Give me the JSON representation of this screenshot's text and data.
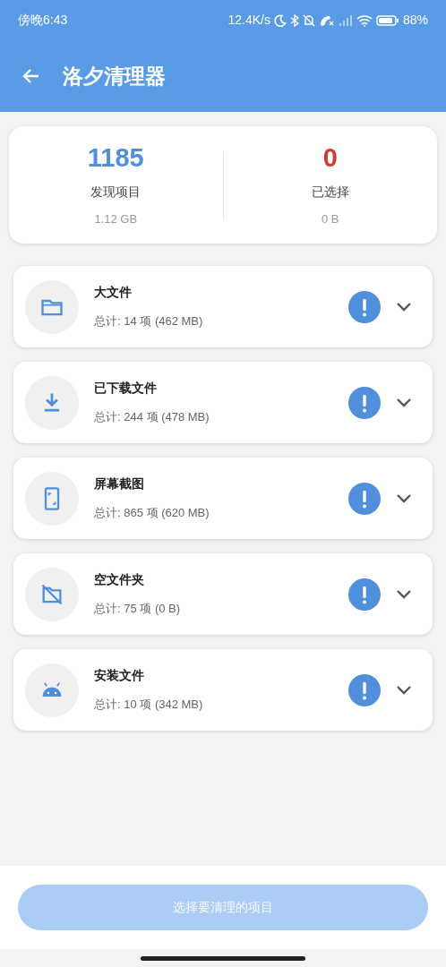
{
  "status_bar": {
    "time": "傍晚6:43",
    "net_speed": "12.4K/s",
    "battery": "88%"
  },
  "app_bar": {
    "title": "洛夕清理器"
  },
  "summary": [
    {
      "kind": "found",
      "value": "1185",
      "label": "发现项目",
      "size": "1.12 GB"
    },
    {
      "kind": "selected",
      "value": "0",
      "label": "已选择",
      "size": "0 B"
    }
  ],
  "categories": [
    {
      "kind": "folder",
      "title": "大文件",
      "detail": "总计: 14 项 (462 MB)",
      "expanded": false
    },
    {
      "kind": "download",
      "title": "已下载文件",
      "detail": "总计: 244 项 (478 MB)",
      "expanded": false
    },
    {
      "kind": "screenshot",
      "title": "屏幕截图",
      "detail": "总计: 865 项 (620 MB)",
      "expanded": false
    },
    {
      "kind": "empty_folder",
      "title": "空文件夹",
      "detail": "总计: 75 项 (0 B)",
      "expanded": false
    },
    {
      "kind": "apk",
      "title": "安装文件",
      "detail": "总计: 10 项 (342 MB)",
      "expanded": false
    }
  ],
  "action_button": {
    "label": "选择要清理的项目",
    "disabled": true
  }
}
